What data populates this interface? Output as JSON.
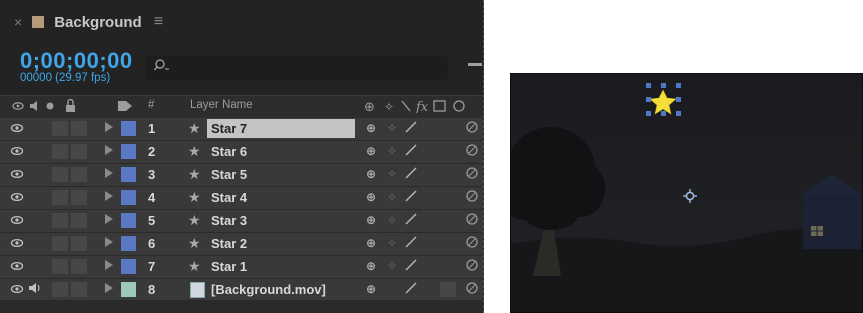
{
  "tab": {
    "close": "×",
    "title": "Background",
    "menu": "≡"
  },
  "timecode": {
    "value": "0;00;00;00",
    "frames": "00000 (29.97 fps)"
  },
  "search": {
    "placeholder": ""
  },
  "header": {
    "layer_name": "Layer Name",
    "number": "#"
  },
  "layers": [
    {
      "num": "1",
      "name": "Star 7",
      "type": "shape",
      "label_color": "#5a78c4",
      "selected": true
    },
    {
      "num": "2",
      "name": "Star 6",
      "type": "shape",
      "label_color": "#5a78c4",
      "selected": false
    },
    {
      "num": "3",
      "name": "Star 5",
      "type": "shape",
      "label_color": "#5a78c4",
      "selected": false
    },
    {
      "num": "4",
      "name": "Star 4",
      "type": "shape",
      "label_color": "#5a78c4",
      "selected": false
    },
    {
      "num": "5",
      "name": "Star 3",
      "type": "shape",
      "label_color": "#5a78c4",
      "selected": false
    },
    {
      "num": "6",
      "name": "Star 2",
      "type": "shape",
      "label_color": "#5a78c4",
      "selected": false
    },
    {
      "num": "7",
      "name": "Star 1",
      "type": "shape",
      "label_color": "#5a78c4",
      "selected": false
    },
    {
      "num": "8",
      "name": "[Background.mov]",
      "type": "footage",
      "label_color": "#9ec9b8",
      "selected": false
    }
  ],
  "colors": {
    "timecode": "#3fa6e9",
    "star": "#f4df3a",
    "panel": "#232323"
  }
}
